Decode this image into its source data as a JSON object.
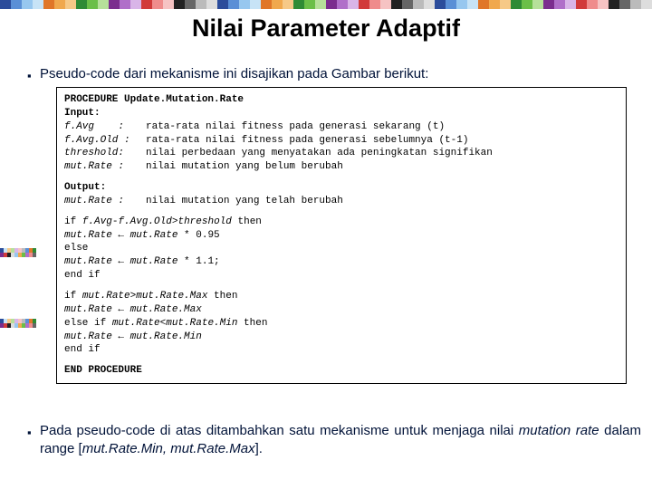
{
  "title": "Nilai Parameter Adaptif",
  "bullet1": "Pseudo-code dari mekanisme ini disajikan pada Gambar berikut:",
  "code": {
    "proc": "PROCEDURE Update.Mutation.Rate",
    "input_label": "Input:",
    "params": [
      {
        "name": "f.Avg    :",
        "desc": "rata-rata nilai fitness pada generasi sekarang (t)"
      },
      {
        "name": "f.Avg.Old :",
        "desc": "rata-rata nilai fitness pada generasi sebelumnya (t-1)"
      },
      {
        "name": "threshold:",
        "desc": "nilai perbedaan yang menyatakan ada peningkatan signifikan"
      },
      {
        "name": "mut.Rate :",
        "desc": "nilai mutation yang belum berubah"
      }
    ],
    "output_label": "Output:",
    "outputs": [
      {
        "name": "mut.Rate :",
        "desc": "nilai mutation yang telah berubah"
      }
    ],
    "block1": {
      "l1a": "if ",
      "l1b": "f.Avg",
      "l1c": "-",
      "l1d": "f.Avg.Old",
      "l1e": ">",
      "l1f": "threshold",
      "l1g": " then",
      "l2a": "   ",
      "l2b": "mut.Rate",
      "l2c": " ← ",
      "l2d": "mut.Rate",
      "l2e": " * 0.95",
      "l3": "else",
      "l4a": "   ",
      "l4b": "mut.Rate",
      "l4c": " ← ",
      "l4d": "mut.Rate",
      "l4e": " * 1.1;",
      "l5": "end if"
    },
    "block2": {
      "l1a": "if ",
      "l1b": "mut.Rate",
      "l1c": ">",
      "l1d": "mut.Rate.Max",
      "l1e": " then",
      "l2a": "   ",
      "l2b": "mut.Rate",
      "l2c": " ← ",
      "l2d": "mut.Rate.Max",
      "l3a": "else if ",
      "l3b": "mut.Rate",
      "l3c": "<",
      "l3d": "mut.Rate.Min",
      "l3e": " then",
      "l4a": "   ",
      "l4b": "mut.Rate",
      "l4c": " ← ",
      "l4d": "mut.Rate.Min",
      "l5": "end if"
    },
    "end": "END PROCEDURE"
  },
  "bullet2": {
    "p1": "Pada pseudo-code di atas ditambahkan satu mekanisme untuk menjaga nilai ",
    "i1": "mutation rate",
    "p2": " dalam range [",
    "i2": "mut.Rate.Min, mut.Rate.Max",
    "p3": "]."
  },
  "top_colors": [
    "#2b4c9b",
    "#5a8fd6",
    "#97c7ef",
    "#c7e3f6",
    "#e07628",
    "#f0a84d",
    "#f6c987",
    "#2f8b35",
    "#6bbf48",
    "#b6e09a",
    "#7b2d8e",
    "#b06fc9",
    "#d9b5e8",
    "#d13a3a",
    "#ef8c8c",
    "#f6c3c3",
    "#222",
    "#666",
    "#bbb",
    "#ddd"
  ]
}
